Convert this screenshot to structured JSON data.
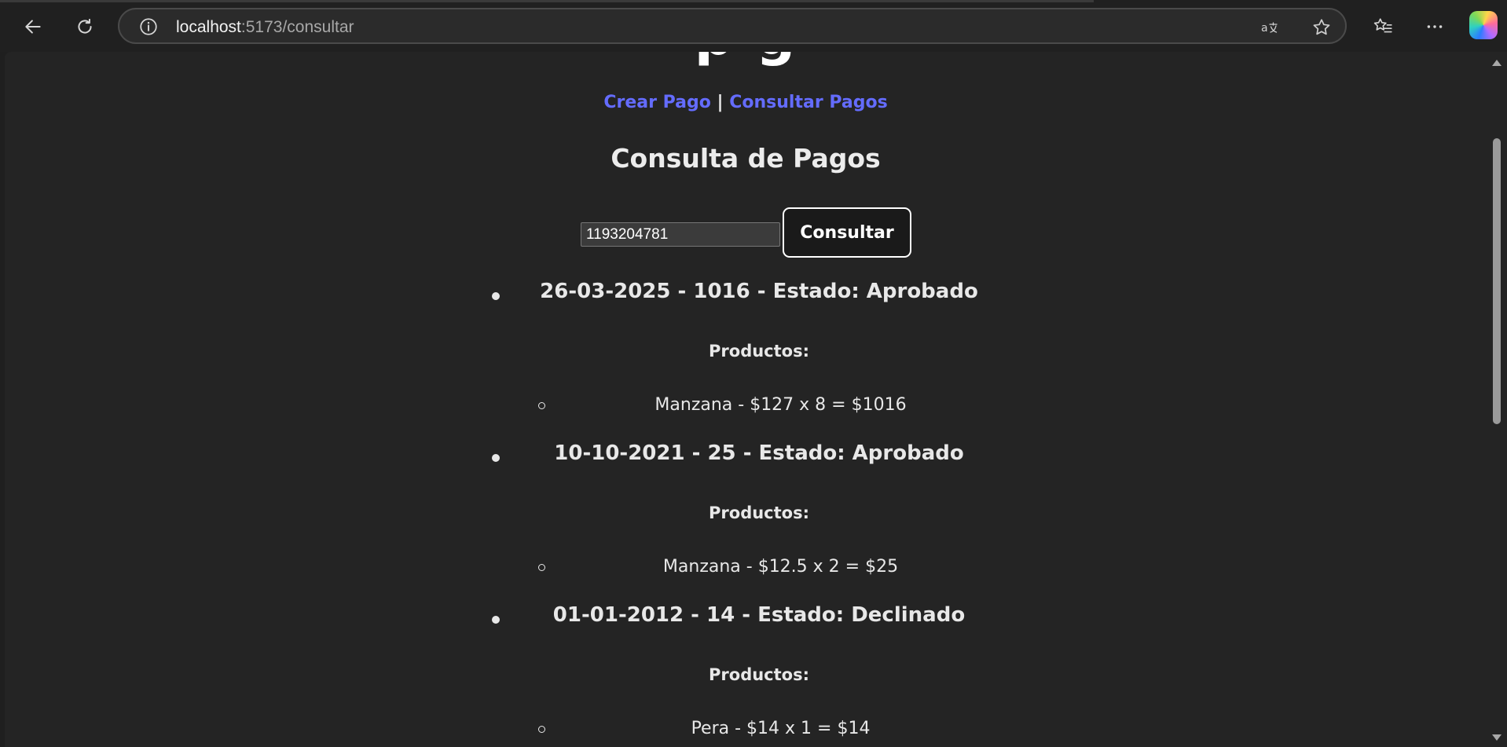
{
  "browser": {
    "url_host": "localhost",
    "url_path": ":5173/consultar"
  },
  "page": {
    "nav": {
      "crear_label": "Crear Pago",
      "separator": "|",
      "consultar_label": "Consultar Pagos"
    },
    "heading": "Consulta de Pagos",
    "search": {
      "value": "1193204781"
    },
    "consult_button": "Consultar",
    "pagos": [
      {
        "title": "26-03-2025 - 1016 - Estado: Aprobado",
        "productos_label": "Productos:",
        "productos": [
          "Manzana - $127 x 8 = $1016"
        ]
      },
      {
        "title": "10-10-2021 - 25 - Estado: Aprobado",
        "productos_label": "Productos:",
        "productos": [
          "Manzana - $12.5 x 2 = $25"
        ]
      },
      {
        "title": "01-01-2012 - 14 - Estado: Declinado",
        "productos_label": "Productos:",
        "productos": [
          "Pera - $14 x 1 = $14"
        ]
      }
    ]
  },
  "colors": {
    "link": "#646cff",
    "background": "#242424"
  }
}
